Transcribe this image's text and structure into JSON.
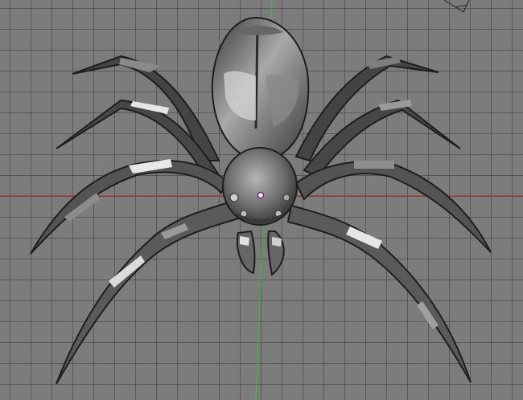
{
  "viewport": {
    "background": "#7c7c7c",
    "grid_color": "#3c3c3c",
    "axis_x_color": "#b03030",
    "axis_y_color": "#3fb83f"
  },
  "model": {
    "icon": "spider-mesh-icon",
    "body_color": "#5f5f5f",
    "shadow_color": "#2a2a2a",
    "highlight_color": "#d9d9d9"
  },
  "overlays": {
    "camera_icon": "camera-corner-icon",
    "origin_icon": "object-origin-icon"
  }
}
